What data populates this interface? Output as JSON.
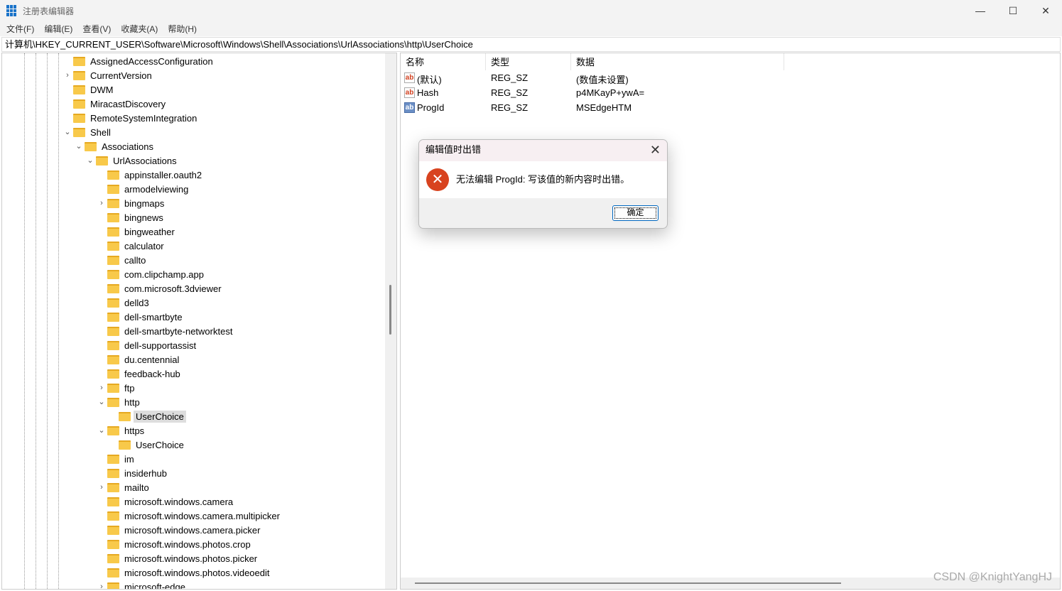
{
  "window": {
    "title": "注册表编辑器",
    "minimize": "—",
    "maximize": "☐",
    "close": "✕"
  },
  "menu": [
    "文件(F)",
    "编辑(E)",
    "查看(V)",
    "收藏夹(A)",
    "帮助(H)"
  ],
  "address": "计算机\\HKEY_CURRENT_USER\\Software\\Microsoft\\Windows\\Shell\\Associations\\UrlAssociations\\http\\UserChoice",
  "tree": [
    {
      "label": "AssignedAccessConfiguration",
      "level": 0,
      "state": "none"
    },
    {
      "label": "CurrentVersion",
      "level": 0,
      "state": "collapsed"
    },
    {
      "label": "DWM",
      "level": 0,
      "state": "none"
    },
    {
      "label": "MiracastDiscovery",
      "level": 0,
      "state": "none"
    },
    {
      "label": "RemoteSystemIntegration",
      "level": 0,
      "state": "none"
    },
    {
      "label": "Shell",
      "level": 0,
      "state": "expanded"
    },
    {
      "label": "Associations",
      "level": 1,
      "state": "expanded"
    },
    {
      "label": "UrlAssociations",
      "level": 2,
      "state": "expanded"
    },
    {
      "label": "appinstaller.oauth2",
      "level": 3,
      "state": "none"
    },
    {
      "label": "armodelviewing",
      "level": 3,
      "state": "none"
    },
    {
      "label": "bingmaps",
      "level": 3,
      "state": "collapsed"
    },
    {
      "label": "bingnews",
      "level": 3,
      "state": "none"
    },
    {
      "label": "bingweather",
      "level": 3,
      "state": "none"
    },
    {
      "label": "calculator",
      "level": 3,
      "state": "none"
    },
    {
      "label": "callto",
      "level": 3,
      "state": "none"
    },
    {
      "label": "com.clipchamp.app",
      "level": 3,
      "state": "none"
    },
    {
      "label": "com.microsoft.3dviewer",
      "level": 3,
      "state": "none"
    },
    {
      "label": "delld3",
      "level": 3,
      "state": "none"
    },
    {
      "label": "dell-smartbyte",
      "level": 3,
      "state": "none"
    },
    {
      "label": "dell-smartbyte-networktest",
      "level": 3,
      "state": "none"
    },
    {
      "label": "dell-supportassist",
      "level": 3,
      "state": "none"
    },
    {
      "label": "du.centennial",
      "level": 3,
      "state": "none"
    },
    {
      "label": "feedback-hub",
      "level": 3,
      "state": "none"
    },
    {
      "label": "ftp",
      "level": 3,
      "state": "collapsed"
    },
    {
      "label": "http",
      "level": 3,
      "state": "expanded"
    },
    {
      "label": "UserChoice",
      "level": 4,
      "state": "none",
      "selected": true
    },
    {
      "label": "https",
      "level": 3,
      "state": "expanded"
    },
    {
      "label": "UserChoice",
      "level": 4,
      "state": "none"
    },
    {
      "label": "im",
      "level": 3,
      "state": "none"
    },
    {
      "label": "insiderhub",
      "level": 3,
      "state": "none"
    },
    {
      "label": "mailto",
      "level": 3,
      "state": "collapsed"
    },
    {
      "label": "microsoft.windows.camera",
      "level": 3,
      "state": "none"
    },
    {
      "label": "microsoft.windows.camera.multipicker",
      "level": 3,
      "state": "none"
    },
    {
      "label": "microsoft.windows.camera.picker",
      "level": 3,
      "state": "none"
    },
    {
      "label": "microsoft.windows.photos.crop",
      "level": 3,
      "state": "none"
    },
    {
      "label": "microsoft.windows.photos.picker",
      "level": 3,
      "state": "none"
    },
    {
      "label": "microsoft.windows.photos.videoedit",
      "level": 3,
      "state": "none"
    },
    {
      "label": "microsoft-edge",
      "level": 3,
      "state": "collapsed"
    }
  ],
  "values": {
    "headers": {
      "name": "名称",
      "type": "类型",
      "data": "数据"
    },
    "rows": [
      {
        "name": "(默认)",
        "type": "REG_SZ",
        "data": "(数值未设置)",
        "icon": "string-value-icon"
      },
      {
        "name": "Hash",
        "type": "REG_SZ",
        "data": "p4MKayP+ywA=",
        "icon": "string-value-icon"
      },
      {
        "name": "ProgId",
        "type": "REG_SZ",
        "data": "MSEdgeHTM",
        "icon": "string-value-icon",
        "selected": true
      }
    ]
  },
  "dialog": {
    "title": "编辑值时出错",
    "message": "无法编辑 ProgId: 写该值的新内容时出错。",
    "ok": "确定",
    "icon": "error-icon",
    "close": "✕"
  },
  "watermark": "CSDN @KnightYangHJ"
}
